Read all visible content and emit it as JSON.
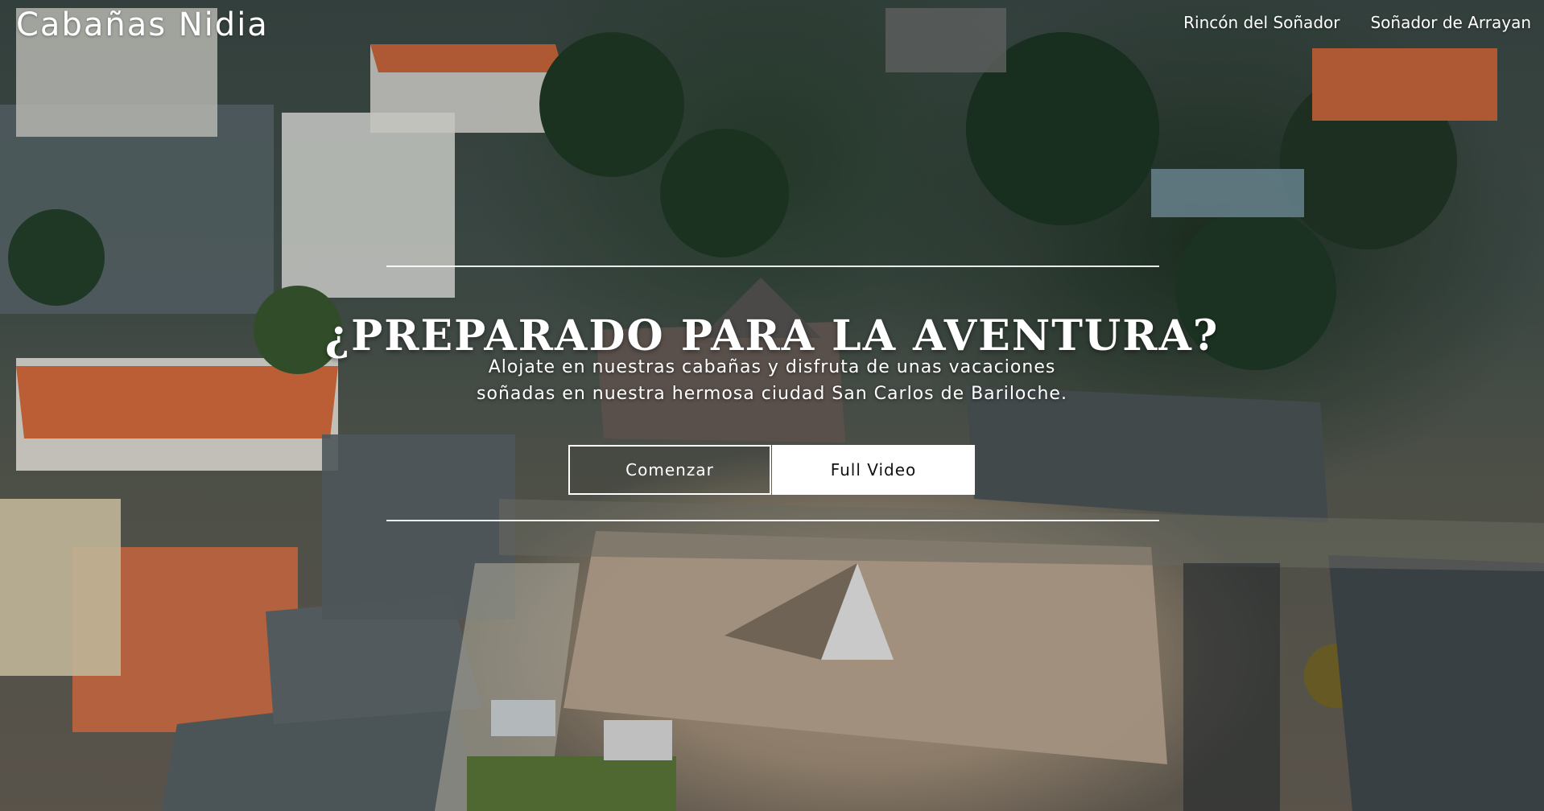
{
  "header": {
    "brand": "Cabañas Nidia",
    "nav": [
      {
        "label": "Rincón del Soñador"
      },
      {
        "label": "Soñador de Arrayan"
      }
    ]
  },
  "hero": {
    "title": "¿PREPARADO PARA LA AVENTURA?",
    "subtitle_line1": "Alojate en nuestras cabañas y disfruta de unas vacaciones",
    "subtitle_line2": "soñadas en nuestra hermosa ciudad San Carlos de Bariloche.",
    "buttons": {
      "start": "Comenzar",
      "video": "Full Video"
    }
  },
  "colors": {
    "text": "#ffffff",
    "button_solid_bg": "#ffffff",
    "button_solid_text": "#111111"
  }
}
